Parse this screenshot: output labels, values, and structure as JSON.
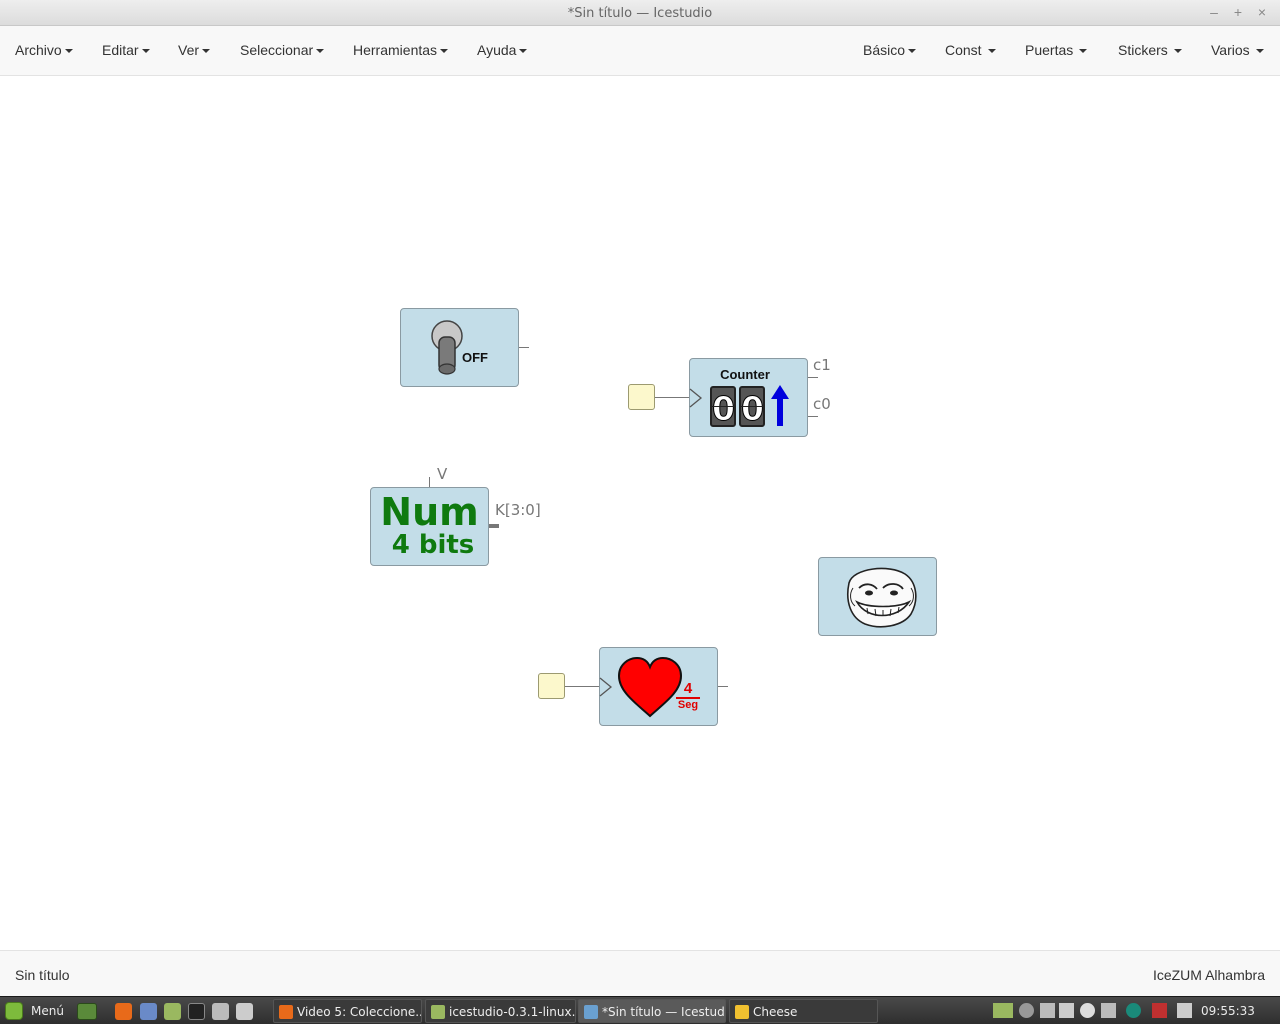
{
  "window": {
    "title": "*Sin título — Icestudio",
    "minimize_glyph": "–",
    "maximize_glyph": "+",
    "close_glyph": "×"
  },
  "menu": {
    "left": [
      {
        "label": "Archivo"
      },
      {
        "label": "Editar"
      },
      {
        "label": "Ver"
      },
      {
        "label": "Seleccionar"
      },
      {
        "label": "Herramientas"
      },
      {
        "label": "Ayuda"
      }
    ],
    "right": [
      {
        "label": "Básico"
      },
      {
        "label": "Const"
      },
      {
        "label": "Puertas"
      },
      {
        "label": "Stickers"
      },
      {
        "label": "Varios"
      }
    ]
  },
  "canvas": {
    "switch_block": {
      "state_text": "OFF"
    },
    "counter_block": {
      "title": "Counter",
      "digits": [
        "0",
        "0"
      ],
      "outputs": [
        "c1",
        "c0"
      ]
    },
    "num_block": {
      "line1": "Num",
      "line2": "4 bits",
      "param_label": "V",
      "output_label": "K[3:0]"
    },
    "heart_block": {
      "numerator": "4",
      "denominator": "Seg"
    }
  },
  "status": {
    "project_name": "Sin título",
    "board_name": "IceZUM Alhambra"
  },
  "taskbar": {
    "menu_label": "Menú",
    "tasks": [
      {
        "label": "Video 5: Coleccione...",
        "icon": "firefox-icon"
      },
      {
        "label": "icestudio-0.3.1-linux...",
        "icon": "folder-icon"
      },
      {
        "label": "*Sin título — Icestudio",
        "icon": "icestudio-icon"
      },
      {
        "label": "Cheese",
        "icon": "cheese-icon"
      }
    ],
    "clock": "09:55:33"
  },
  "colors": {
    "block_fill": "#c3dde8",
    "block_border": "#8a9aa2",
    "num_text": "#0f7a0f",
    "counter_arrow": "#0000dd",
    "heart": "#ff0000",
    "input_port": "#fcf8cc"
  }
}
